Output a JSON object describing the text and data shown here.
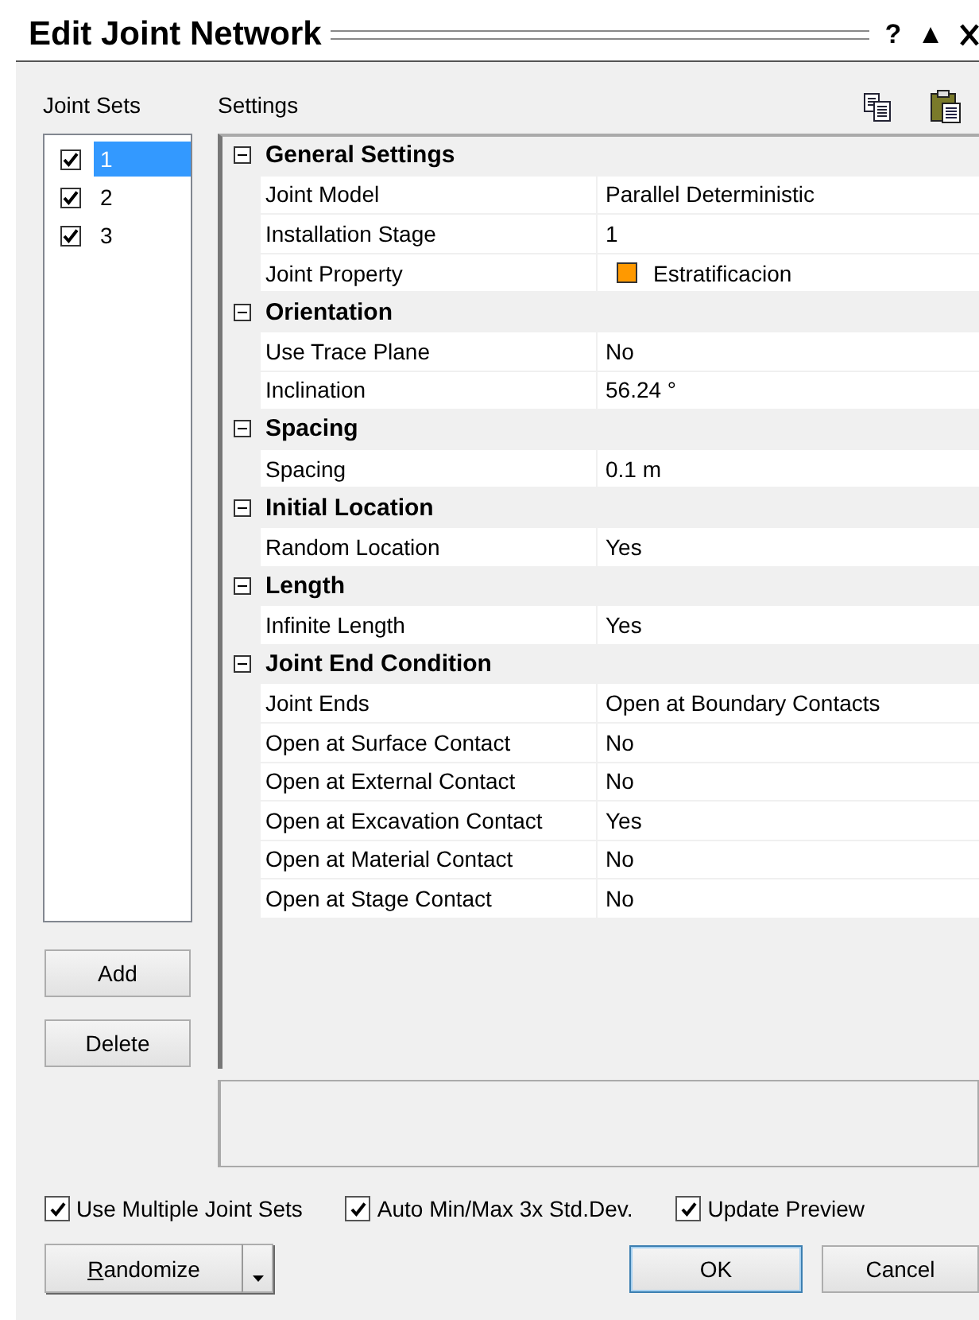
{
  "window": {
    "title": "Edit Joint Network",
    "header_buttons": [
      "?",
      "▲"
    ]
  },
  "joint_sets": {
    "label": "Joint Sets",
    "items": [
      {
        "label": "1",
        "checked": true,
        "selected": true
      },
      {
        "label": "2",
        "checked": true,
        "selected": false
      },
      {
        "label": "3",
        "checked": true,
        "selected": false
      }
    ],
    "buttons": [
      "Add",
      "Delete"
    ]
  },
  "settings": {
    "label": "Settings",
    "groups": [
      {
        "title": "General Settings",
        "expanded": true,
        "properties": [
          {
            "name": "Joint Model",
            "value": "Parallel Deterministic"
          },
          {
            "name": "Installation Stage",
            "value": "1"
          },
          {
            "name": "Joint Property",
            "value": "Estratificacion",
            "color": "#ff9900"
          }
        ]
      },
      {
        "title": "Orientation",
        "expanded": true,
        "properties": [
          {
            "name": "Use Trace Plane",
            "value": "No"
          },
          {
            "name": "Inclination",
            "value": "56.24 °"
          }
        ]
      },
      {
        "title": "Spacing",
        "expanded": true,
        "properties": [
          {
            "name": "Spacing",
            "value": "0.1 m"
          }
        ]
      },
      {
        "title": "Initial Location",
        "expanded": true,
        "properties": [
          {
            "name": "Random Location",
            "value": "Yes"
          }
        ]
      },
      {
        "title": "Length",
        "expanded": true,
        "properties": [
          {
            "name": "Infinite Length",
            "value": "Yes"
          }
        ]
      },
      {
        "title": "Joint End Condition",
        "expanded": true,
        "properties": [
          {
            "name": "Joint Ends",
            "value": "Open at Boundary Contacts"
          },
          {
            "name": "Open at Surface Contact",
            "value": "No"
          },
          {
            "name": "Open at External Contact",
            "value": "No"
          },
          {
            "name": "Open at Excavation Contact",
            "value": "Yes"
          },
          {
            "name": "Open at Material Contact",
            "value": "No"
          },
          {
            "name": "Open at Stage Contact",
            "value": "No"
          }
        ]
      }
    ]
  },
  "options": [
    {
      "label": "Use Multiple Joint Sets",
      "checked": true
    },
    {
      "label": "Auto Min/Max 3x Std.Dev.",
      "checked": true
    },
    {
      "label": "Update Preview",
      "checked": true
    }
  ],
  "randomize_button": {
    "label": "Randomize"
  },
  "buttons": [
    {
      "label": "OK",
      "default": true
    },
    {
      "label": "Cancel",
      "default": false
    }
  ]
}
